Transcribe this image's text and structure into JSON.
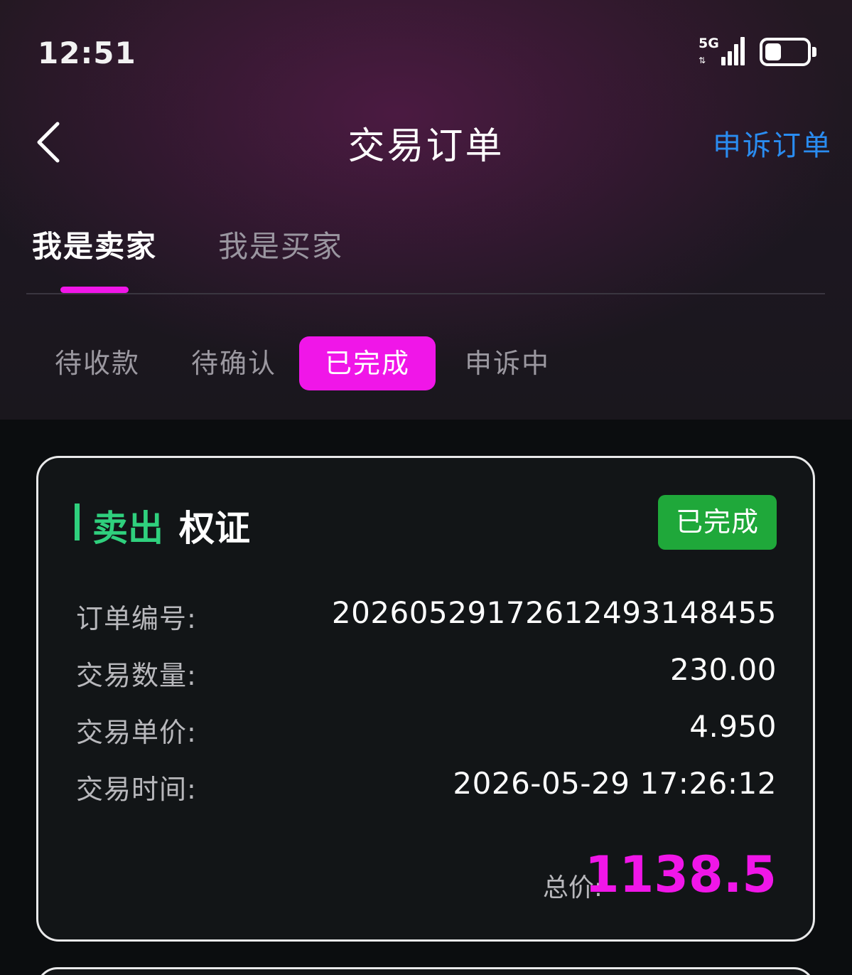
{
  "status_bar": {
    "time": "12:51",
    "network": "5G",
    "battery_level": 0.4
  },
  "header": {
    "title": "交易订单",
    "appeal_link": "申诉订单"
  },
  "role_tabs": [
    {
      "label": "我是卖家",
      "active": true
    },
    {
      "label": "我是买家",
      "active": false
    }
  ],
  "status_tabs": [
    {
      "label": "待收款",
      "active": false
    },
    {
      "label": "待确认",
      "active": false
    },
    {
      "label": "已完成",
      "active": true
    },
    {
      "label": "申诉中",
      "active": false
    }
  ],
  "order": {
    "side": "卖出",
    "asset": "权证",
    "status": "已完成",
    "rows": [
      {
        "label": "订单编号:",
        "value": "20260529172612493148455"
      },
      {
        "label": "交易数量:",
        "value": "230.00"
      },
      {
        "label": "交易单价:",
        "value": "4.950"
      },
      {
        "label": "交易时间:",
        "value": "2026-05-29 17:26:12"
      }
    ],
    "total_label": "总价:",
    "total_value": "1138.5"
  },
  "colors": {
    "accent": "#f016e8",
    "sell": "#2fd07d",
    "done": "#1fa83a",
    "link": "#2a8cf0"
  }
}
